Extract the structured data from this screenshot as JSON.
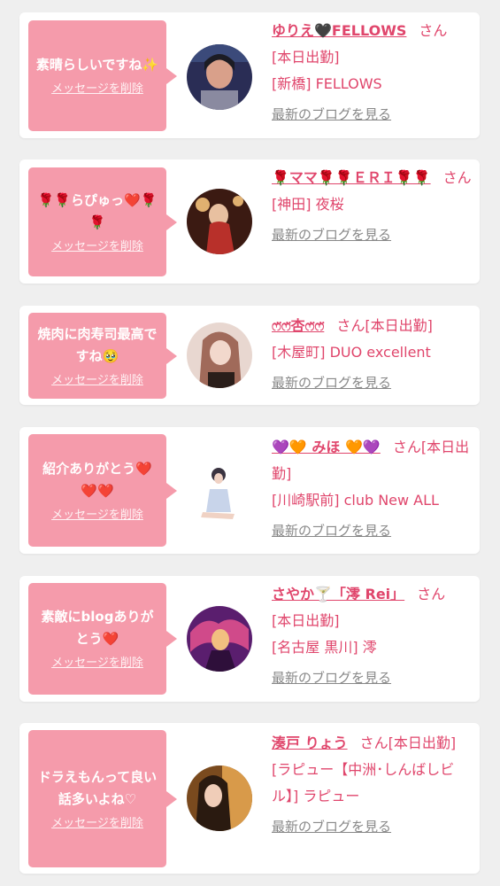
{
  "cards": [
    {
      "message": "素晴らしいですね✨",
      "delete_label": "メッセージを削除",
      "name": "ゆりえ🖤FELLOWS",
      "san": "さん",
      "lines": [
        "[本日出勤]",
        "[新橋] FELLOWS"
      ],
      "blog_label": "最新のブログを見る",
      "avatar_colors": [
        "#2a2d55",
        "#d9a08a",
        "#1c1c24"
      ]
    },
    {
      "message": "🌹🌹らぴゅっ❤️🌹🌹",
      "delete_label": "メッセージを削除",
      "name": "🌹ママ🌹🌹ＥＲＩ🌹🌹",
      "san": "さん",
      "lines": [
        "[神田] 夜桜"
      ],
      "blog_label": "最新のブログを見る",
      "avatar_colors": [
        "#3b1a12",
        "#b8302a",
        "#e0b070"
      ]
    },
    {
      "message": "焼肉に肉寿司最高ですね🥹",
      "delete_label": "メッセージを削除",
      "name": "ෆ̈ෆ̈杏ෆ̈ෆ̈",
      "san": "さん[本日出勤]",
      "lines": [
        "[木屋町] DUO excellent"
      ],
      "blog_label": "最新のブログを見る",
      "avatar_colors": [
        "#e8d7d0",
        "#a06a5a",
        "#2a1e1a"
      ]
    },
    {
      "message": "紹介ありがとう❤️❤️❤️",
      "delete_label": "メッセージを削除",
      "name": "💜🧡 みほ 🧡💜",
      "san": "さん[本日出勤]",
      "lines": [
        "[川崎駅前] club New ALL"
      ],
      "blog_label": "最新のブログを見る",
      "avatar_colors": [
        "#ffffff",
        "#c8d4ea",
        "#3a3340"
      ]
    },
    {
      "message": "素敵にblogありがとう❤️",
      "delete_label": "メッセージを削除",
      "name": "さやか🍸「澪 Rei」",
      "san": "さん",
      "lines": [
        "[本日出勤]",
        "[名古屋 黒川] 澪"
      ],
      "blog_label": "最新のブログを見る",
      "avatar_colors": [
        "#5a1e6e",
        "#d04a8a",
        "#f2c080"
      ]
    },
    {
      "message": "ドラえもんって良い話多いよね♡",
      "delete_label": "メッセージを削除",
      "name": "湊戸 りょう",
      "san": "さん[本日出勤]",
      "lines": [
        "[ラピュー【中洲･しんばしビル】] ラピュー"
      ],
      "blog_label": "最新のブログを見る",
      "avatar_colors": [
        "#7a4a1e",
        "#d89a4a",
        "#2a1a10"
      ]
    }
  ]
}
